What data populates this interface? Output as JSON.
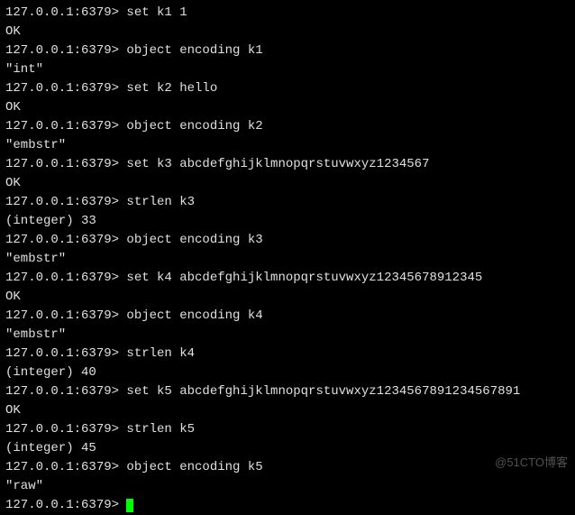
{
  "lines": [
    {
      "prompt": "127.0.0.1:6379> ",
      "cmd": "set k1 1"
    },
    {
      "output": "OK"
    },
    {
      "prompt": "127.0.0.1:6379> ",
      "cmd": "object encoding k1"
    },
    {
      "output": "\"int\""
    },
    {
      "prompt": "127.0.0.1:6379> ",
      "cmd": "set k2 hello"
    },
    {
      "output": "OK"
    },
    {
      "prompt": "127.0.0.1:6379> ",
      "cmd": "object encoding k2"
    },
    {
      "output": "\"embstr\""
    },
    {
      "prompt": "127.0.0.1:6379> ",
      "cmd": "set k3 abcdefghijklmnopqrstuvwxyz1234567"
    },
    {
      "output": "OK"
    },
    {
      "prompt": "127.0.0.1:6379> ",
      "cmd": "strlen k3"
    },
    {
      "output": "(integer) 33"
    },
    {
      "prompt": "127.0.0.1:6379> ",
      "cmd": "object encoding k3"
    },
    {
      "output": "\"embstr\""
    },
    {
      "prompt": "127.0.0.1:6379> ",
      "cmd": "set k4 abcdefghijklmnopqrstuvwxyz12345678912345"
    },
    {
      "output": "OK"
    },
    {
      "prompt": "127.0.0.1:6379> ",
      "cmd": "object encoding k4"
    },
    {
      "output": "\"embstr\""
    },
    {
      "prompt": "127.0.0.1:6379> ",
      "cmd": "strlen k4"
    },
    {
      "output": "(integer) 40"
    },
    {
      "prompt": "127.0.0.1:6379> ",
      "cmd": "set k5 abcdefghijklmnopqrstuvwxyz1234567891234567891"
    },
    {
      "output": "OK"
    },
    {
      "prompt": "127.0.0.1:6379> ",
      "cmd": "strlen k5"
    },
    {
      "output": "(integer) 45"
    },
    {
      "prompt": "127.0.0.1:6379> ",
      "cmd": "object encoding k5"
    },
    {
      "output": "\"raw\""
    },
    {
      "prompt": "127.0.0.1:6379> ",
      "cmd": "",
      "cursor": true
    }
  ],
  "watermark": "@51CTO博客"
}
